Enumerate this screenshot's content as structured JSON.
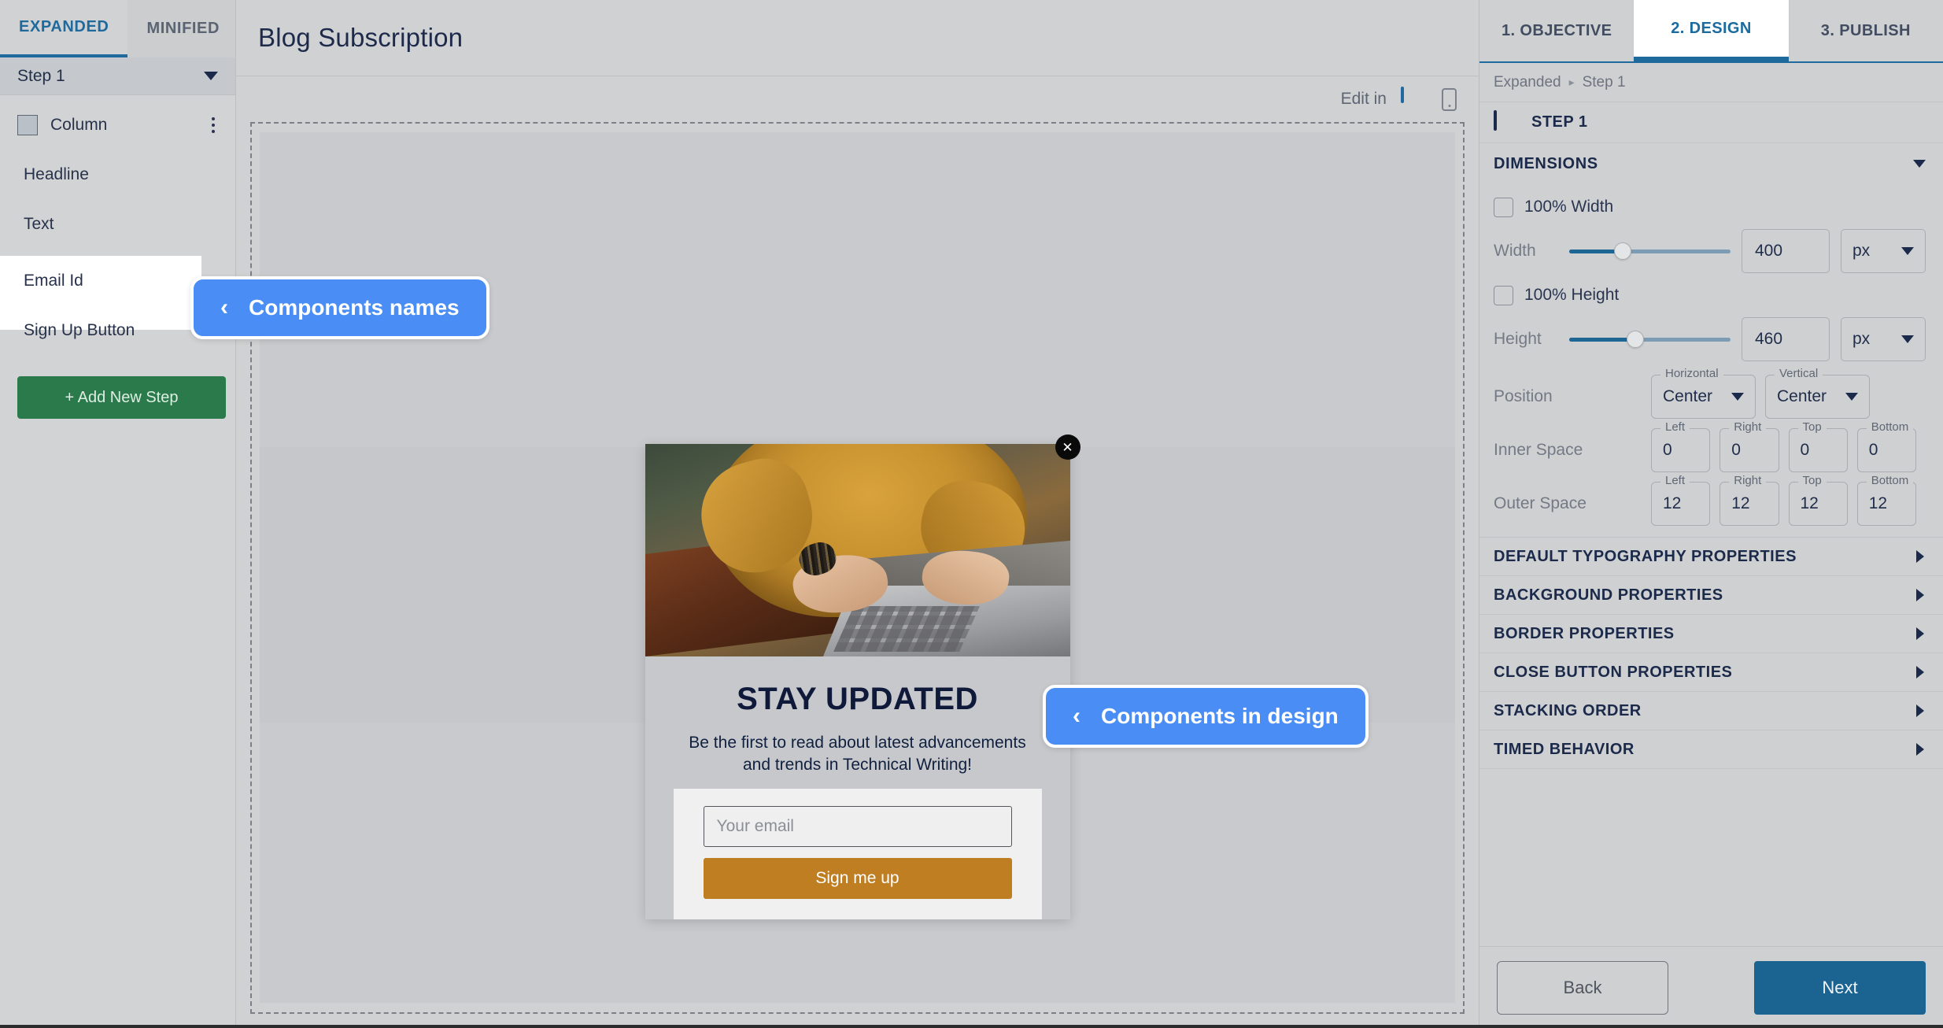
{
  "left_sidebar": {
    "tabs": [
      {
        "label": "EXPANDED",
        "active": true
      },
      {
        "label": "MINIFIED",
        "active": false
      }
    ],
    "step_selector": {
      "value": "Step 1",
      "icon": "chevron-down-icon"
    },
    "tree": [
      {
        "label": "Column",
        "has_swatch": true,
        "has_menu": true
      },
      {
        "label": "Headline",
        "has_swatch": false,
        "has_menu": false
      },
      {
        "label": "Text",
        "has_swatch": false,
        "has_menu": false
      },
      {
        "label": "Email Id",
        "has_swatch": false,
        "has_menu": false
      },
      {
        "label": "Sign Up Button",
        "has_swatch": false,
        "has_menu": false
      }
    ],
    "add_step_button": "+ Add New Step"
  },
  "center": {
    "title": "Blog Subscription",
    "edit_in_label": "Edit in",
    "device_icons": [
      "monitor-icon",
      "mobile-icon"
    ]
  },
  "modal": {
    "close_icon": "close-icon",
    "image_alt": "woman-typing-on-laptop",
    "headline": "STAY UPDATED",
    "body_text": "Be the first to read about latest advancements and trends in Technical Writing!",
    "email_placeholder": "Your email",
    "email_value": "",
    "submit_label": "Sign me up",
    "submit_color": "#c07e23"
  },
  "callouts": [
    {
      "id": "names",
      "chevron": "‹",
      "label": "Components names",
      "color": "#4a8df5"
    },
    {
      "id": "design",
      "chevron": "‹",
      "label": "Components in design",
      "color": "#4a8df5"
    }
  ],
  "right_panel": {
    "tabs": [
      {
        "label": "1. OBJECTIVE",
        "active": false
      },
      {
        "label": "2. DESIGN",
        "active": true
      },
      {
        "label": "3. PUBLISH",
        "active": false
      }
    ],
    "breadcrumb": {
      "parent": "Expanded",
      "separator": "▸",
      "current": "Step 1"
    },
    "step_title": {
      "icon": "monitor-icon",
      "label": "STEP 1"
    },
    "dimensions": {
      "header": "DIMENSIONS",
      "full_width": {
        "label": "100% Width",
        "checked": false
      },
      "width": {
        "label": "Width",
        "value": "400",
        "unit": "px",
        "slider_percent": 23
      },
      "full_height": {
        "label": "100% Height",
        "checked": false
      },
      "height": {
        "label": "Height",
        "value": "460",
        "unit": "px",
        "slider_percent": 45
      },
      "position": {
        "label": "Position",
        "horizontal": {
          "legend": "Horizontal",
          "value": "Center"
        },
        "vertical": {
          "legend": "Vertical",
          "value": "Center"
        }
      },
      "inner_space": {
        "label": "Inner Space",
        "left": {
          "legend": "Left",
          "value": "0"
        },
        "right": {
          "legend": "Right",
          "value": "0"
        },
        "top": {
          "legend": "Top",
          "value": "0"
        },
        "bottom": {
          "legend": "Bottom",
          "value": "0"
        }
      },
      "outer_space": {
        "label": "Outer Space",
        "left": {
          "legend": "Left",
          "value": "12"
        },
        "right": {
          "legend": "Right",
          "value": "12"
        },
        "top": {
          "legend": "Top",
          "value": "12"
        },
        "bottom": {
          "legend": "Bottom",
          "value": "12"
        }
      }
    },
    "sections": [
      {
        "label": "DEFAULT TYPOGRAPHY PROPERTIES"
      },
      {
        "label": "BACKGROUND PROPERTIES"
      },
      {
        "label": "BORDER PROPERTIES"
      },
      {
        "label": "CLOSE BUTTON PROPERTIES"
      },
      {
        "label": "STACKING ORDER"
      },
      {
        "label": "TIMED BEHAVIOR"
      }
    ],
    "footer": {
      "back": "Back",
      "next": "Next"
    }
  }
}
